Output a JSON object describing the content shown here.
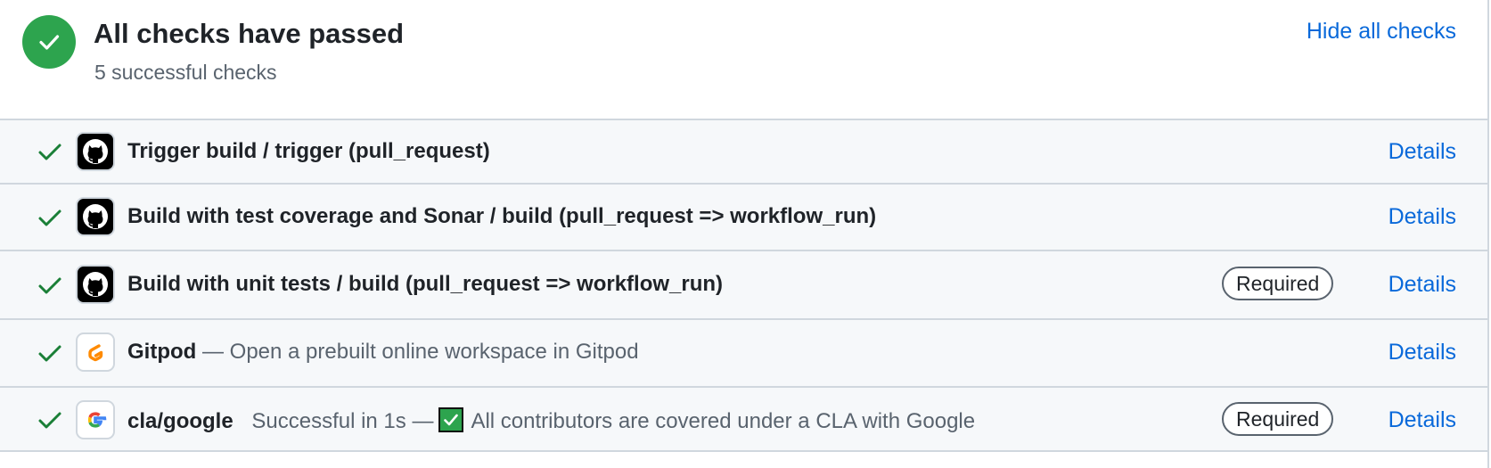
{
  "header": {
    "title": "All checks have passed",
    "subtitle": "5 successful checks",
    "hide_link": "Hide all checks",
    "status_icon": "check-circle-icon",
    "accent": "#2da44e"
  },
  "checks": [
    {
      "name": "Trigger build / trigger (pull_request)",
      "icon": "github-icon",
      "desc_prefix": "",
      "description": "",
      "required": "",
      "details": "Details"
    },
    {
      "name": "Build with test coverage and Sonar / build (pull_request => workflow_run)",
      "icon": "github-icon",
      "desc_prefix": "",
      "description": "",
      "required": "",
      "details": "Details"
    },
    {
      "name": "Build with unit tests / build (pull_request => workflow_run)",
      "icon": "github-icon",
      "desc_prefix": "",
      "description": "",
      "required": "Required",
      "details": "Details"
    },
    {
      "name": "Gitpod",
      "icon": "gitpod-icon",
      "desc_prefix": "",
      "description": "— Open a prebuilt online workspace in Gitpod",
      "required": "",
      "details": "Details"
    },
    {
      "name": "cla/google",
      "icon": "google-icon",
      "desc_prefix": "Successful in 1s —",
      "description": "All contributors are covered under a CLA with Google",
      "required": "Required",
      "details": "Details"
    }
  ],
  "colors": {
    "success": "#2da44e",
    "link": "#0969da",
    "row_bg": "#f6f8fa",
    "border": "#d0d7de",
    "muted": "#59636e"
  }
}
